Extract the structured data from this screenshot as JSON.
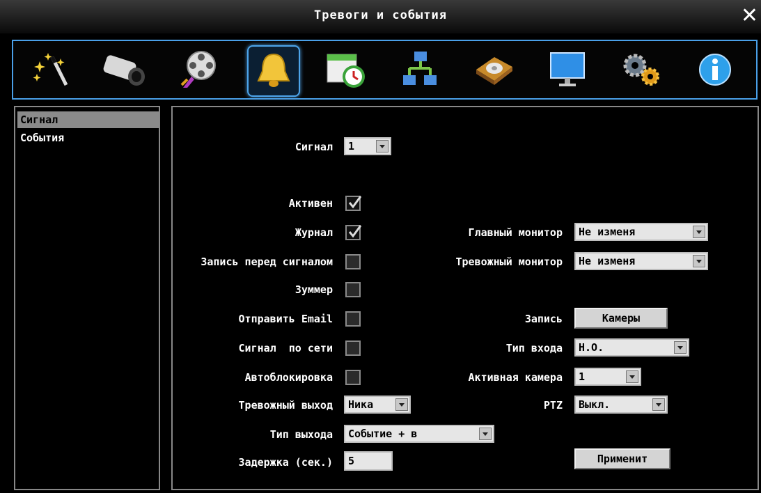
{
  "window": {
    "title": "Тревоги и события",
    "close": "✕"
  },
  "toolbar": [
    {
      "name": "wizard-icon"
    },
    {
      "name": "camera-icon"
    },
    {
      "name": "film-reel-icon"
    },
    {
      "name": "alarm-bell-icon",
      "active": true
    },
    {
      "name": "schedule-icon"
    },
    {
      "name": "network-icon"
    },
    {
      "name": "disk-icon"
    },
    {
      "name": "monitor-icon"
    },
    {
      "name": "settings-gears-icon"
    },
    {
      "name": "info-icon"
    }
  ],
  "sidebar": {
    "items": [
      {
        "label": "Сигнал"
      },
      {
        "label": "События"
      }
    ]
  },
  "form": {
    "alarm_label": "Сигнал",
    "alarm_value": "1",
    "active_label": "Активен",
    "active_checked": true,
    "log_label": "Журнал",
    "log_checked": true,
    "main_monitor_label": "Главный монитор",
    "main_monitor_value": "Не изменя",
    "prealarm_label": "Запись перед сигналом",
    "prealarm_checked": false,
    "alarm_monitor_label": "Тревожный монитор",
    "alarm_monitor_value": "Не изменя",
    "buzzer_label": "Зуммер",
    "buzzer_checked": false,
    "email_label": "Отправить Email",
    "email_checked": false,
    "record_label": "Запись",
    "cameras_button": "Камеры",
    "net_alarm_label": "Сигнал  по сети",
    "net_alarm_checked": false,
    "input_type_label": "Тип входа",
    "input_type_value": "Н.О.",
    "autolock_label": "Автоблокировка",
    "autolock_checked": false,
    "active_camera_label": "Активная камера",
    "active_camera_value": "1",
    "alarm_out_label": "Тревожный выход",
    "alarm_out_value": "Ника",
    "ptz_label": "PTZ",
    "ptz_value": "Выкл.",
    "out_type_label": "Тип выхода",
    "out_type_value": "Событие + в",
    "delay_label": "Задержка (сек.)",
    "delay_value": "5",
    "apply_button": "Применит"
  }
}
